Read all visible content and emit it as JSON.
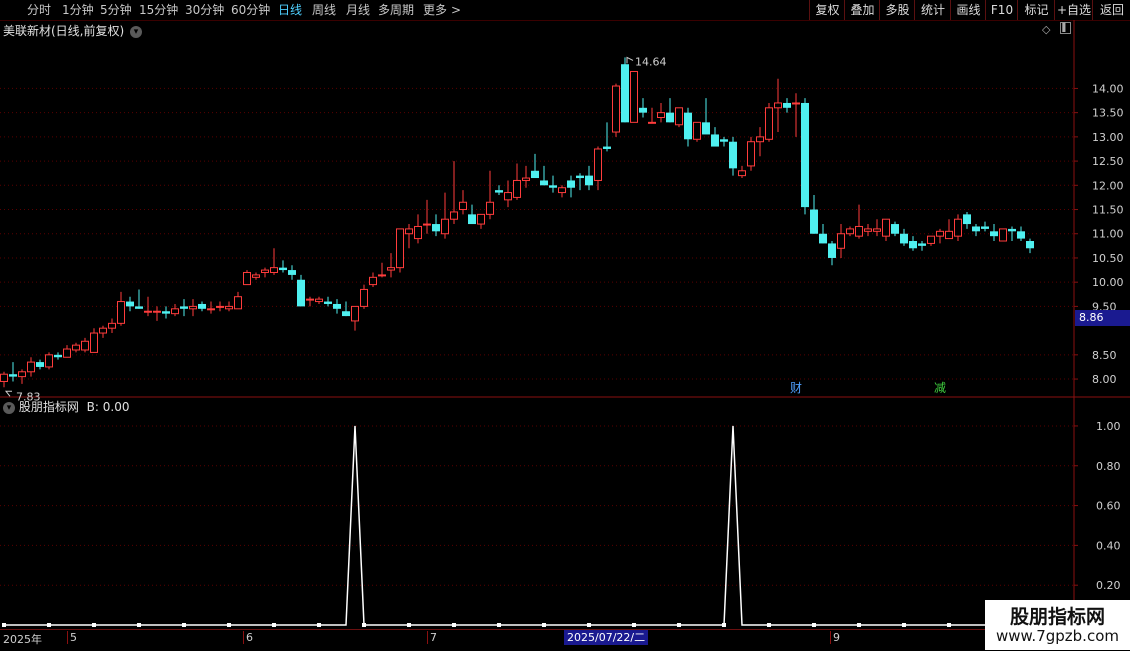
{
  "toolbar": {
    "periods": [
      {
        "label": "分时",
        "active": false
      },
      {
        "label": "1分钟",
        "active": false
      },
      {
        "label": "5分钟",
        "active": false
      },
      {
        "label": "15分钟",
        "active": false
      },
      {
        "label": "30分钟",
        "active": false
      },
      {
        "label": "60分钟",
        "active": false
      },
      {
        "label": "日线",
        "active": true
      },
      {
        "label": "周线",
        "active": false
      },
      {
        "label": "月线",
        "active": false
      },
      {
        "label": "多周期",
        "active": false
      },
      {
        "label": "更多",
        "active": false
      }
    ],
    "more_arrow": ">",
    "right_buttons": [
      "复权",
      "叠加",
      "多股",
      "统计",
      "画线",
      "F10",
      "标记",
      "+自选",
      "返回"
    ]
  },
  "main_chart": {
    "title": "美联新材(日线,前复权)",
    "y_ticks": [
      "14.00",
      "13.50",
      "13.00",
      "12.50",
      "12.00",
      "11.50",
      "11.00",
      "10.50",
      "10.00",
      "9.50",
      "8.50",
      "8.00"
    ],
    "highlight_price": "8.86",
    "max_label": "14.64",
    "min_label": "7.83",
    "markers": [
      {
        "label": "财",
        "color": "#4fa0ff"
      },
      {
        "label": "减",
        "color": "#3fd03f"
      }
    ],
    "colors": {
      "up": "#ff3c3c",
      "down": "#4ff0f0",
      "grid": "#5a0000"
    }
  },
  "indicator": {
    "title": "股朋指标网",
    "b_label": "B: 0.00",
    "y_ticks": [
      "1.00",
      "0.80",
      "0.60",
      "0.40",
      "0.20"
    ]
  },
  "date_axis": {
    "ticks": [
      "2025年",
      "5",
      "6",
      "7",
      "9"
    ],
    "cursor_date": "2025/07/22/二"
  },
  "watermark": {
    "line1": "股朋指标网",
    "line2": "www.7gpzb.com"
  },
  "chart_data": [
    {
      "type": "candlestick",
      "title": "美联新材(日线,前复权)",
      "ylim": [
        7.65,
        15.0
      ],
      "candles": [
        [
          7.95,
          8.15,
          7.83,
          8.1
        ],
        [
          8.1,
          8.35,
          7.95,
          8.05
        ],
        [
          8.05,
          8.2,
          7.9,
          8.15
        ],
        [
          8.15,
          8.45,
          8.05,
          8.35
        ],
        [
          8.35,
          8.4,
          8.2,
          8.25
        ],
        [
          8.25,
          8.55,
          8.2,
          8.5
        ],
        [
          8.5,
          8.55,
          8.4,
          8.45
        ],
        [
          8.45,
          8.7,
          8.45,
          8.62
        ],
        [
          8.6,
          8.75,
          8.55,
          8.7
        ],
        [
          8.6,
          8.85,
          8.55,
          8.78
        ],
        [
          8.55,
          9.05,
          8.55,
          8.95
        ],
        [
          8.95,
          9.1,
          8.85,
          9.05
        ],
        [
          9.05,
          9.25,
          8.95,
          9.15
        ],
        [
          9.15,
          9.8,
          9.1,
          9.6
        ],
        [
          9.6,
          9.7,
          9.4,
          9.5
        ],
        [
          9.5,
          9.85,
          9.45,
          9.45
        ],
        [
          9.4,
          9.7,
          9.3,
          9.4
        ],
        [
          9.4,
          9.5,
          9.2,
          9.4
        ],
        [
          9.4,
          9.5,
          9.25,
          9.35
        ],
        [
          9.35,
          9.55,
          9.3,
          9.45
        ],
        [
          9.5,
          9.65,
          9.3,
          9.45
        ],
        [
          9.45,
          9.65,
          9.3,
          9.5
        ],
        [
          9.55,
          9.6,
          9.4,
          9.45
        ],
        [
          9.45,
          9.6,
          9.35,
          9.45
        ],
        [
          9.5,
          9.6,
          9.4,
          9.5
        ],
        [
          9.45,
          9.6,
          9.4,
          9.5
        ],
        [
          9.45,
          9.8,
          9.45,
          9.7
        ],
        [
          9.95,
          10.25,
          9.95,
          10.2
        ],
        [
          10.1,
          10.2,
          10.05,
          10.15
        ],
        [
          10.2,
          10.3,
          10.1,
          10.25
        ],
        [
          10.2,
          10.7,
          10.15,
          10.3
        ],
        [
          10.3,
          10.45,
          10.2,
          10.25
        ],
        [
          10.25,
          10.35,
          10.05,
          10.15
        ],
        [
          10.05,
          10.15,
          9.65,
          9.5
        ],
        [
          9.65,
          9.7,
          9.5,
          9.65
        ],
        [
          9.6,
          9.7,
          9.55,
          9.65
        ],
        [
          9.6,
          9.7,
          9.5,
          9.55
        ],
        [
          9.55,
          9.65,
          9.35,
          9.45
        ],
        [
          9.4,
          9.6,
          9.3,
          9.3
        ],
        [
          9.2,
          9.5,
          9.0,
          9.5
        ],
        [
          9.5,
          9.95,
          9.45,
          9.85
        ],
        [
          9.95,
          10.2,
          9.9,
          10.1
        ],
        [
          10.15,
          10.4,
          10.1,
          10.15
        ],
        [
          10.25,
          10.6,
          10.1,
          10.3
        ],
        [
          10.3,
          11.1,
          10.2,
          11.1
        ],
        [
          11.0,
          11.2,
          10.7,
          11.1
        ],
        [
          10.9,
          11.4,
          10.8,
          11.15
        ],
        [
          11.2,
          11.7,
          11.0,
          11.2
        ],
        [
          11.2,
          11.4,
          10.95,
          11.05
        ],
        [
          11.0,
          11.85,
          10.9,
          11.3
        ],
        [
          11.3,
          12.5,
          11.2,
          11.45
        ],
        [
          11.5,
          11.9,
          11.4,
          11.65
        ],
        [
          11.4,
          11.6,
          11.2,
          11.2
        ],
        [
          11.2,
          11.4,
          11.1,
          11.4
        ],
        [
          11.4,
          12.3,
          11.3,
          11.65
        ],
        [
          11.9,
          12.0,
          11.8,
          11.85
        ],
        [
          11.7,
          12.1,
          11.55,
          11.85
        ],
        [
          11.75,
          12.45,
          11.7,
          12.1
        ],
        [
          12.1,
          12.4,
          11.95,
          12.15
        ],
        [
          12.3,
          12.65,
          12.2,
          12.15
        ],
        [
          12.1,
          12.4,
          12.0,
          12.0
        ],
        [
          12.0,
          12.2,
          11.85,
          11.95
        ],
        [
          11.85,
          12.0,
          11.75,
          11.95
        ],
        [
          12.1,
          12.2,
          11.75,
          11.95
        ],
        [
          12.2,
          12.25,
          11.9,
          12.15
        ],
        [
          12.2,
          12.4,
          11.9,
          12.0
        ],
        [
          12.1,
          12.8,
          11.9,
          12.75
        ],
        [
          12.8,
          13.3,
          12.7,
          12.75
        ],
        [
          13.1,
          14.1,
          13.0,
          14.05
        ],
        [
          14.5,
          14.64,
          13.3,
          13.3
        ],
        [
          13.3,
          13.9,
          13.3,
          14.35
        ],
        [
          13.6,
          13.8,
          13.4,
          13.5
        ],
        [
          13.3,
          13.6,
          13.3,
          13.3
        ],
        [
          13.4,
          13.7,
          13.3,
          13.5
        ],
        [
          13.5,
          13.8,
          13.3,
          13.3
        ],
        [
          13.25,
          13.6,
          13.2,
          13.6
        ],
        [
          13.5,
          13.6,
          12.8,
          12.95
        ],
        [
          12.95,
          13.3,
          12.9,
          13.3
        ],
        [
          13.3,
          13.8,
          13.2,
          13.05
        ],
        [
          13.05,
          13.2,
          12.8,
          12.8
        ],
        [
          12.95,
          13.0,
          12.8,
          12.9
        ],
        [
          12.9,
          13.0,
          12.2,
          12.35
        ],
        [
          12.2,
          12.4,
          12.15,
          12.3
        ],
        [
          12.4,
          13.0,
          12.3,
          12.9
        ],
        [
          12.9,
          13.2,
          12.6,
          13.0
        ],
        [
          12.95,
          13.7,
          12.9,
          13.6
        ],
        [
          13.6,
          14.2,
          13.1,
          13.7
        ],
        [
          13.7,
          13.8,
          13.5,
          13.6
        ],
        [
          13.7,
          13.9,
          13.0,
          13.7
        ],
        [
          13.7,
          13.8,
          11.4,
          11.55
        ],
        [
          11.5,
          11.8,
          11.0,
          11.0
        ],
        [
          11.0,
          11.2,
          10.8,
          10.8
        ],
        [
          10.8,
          10.85,
          10.35,
          10.5
        ],
        [
          10.7,
          11.2,
          10.5,
          11.0
        ],
        [
          11.0,
          11.15,
          10.95,
          11.1
        ],
        [
          10.95,
          11.6,
          10.9,
          11.15
        ],
        [
          11.05,
          11.2,
          10.95,
          11.1
        ],
        [
          11.05,
          11.3,
          10.95,
          11.1
        ],
        [
          10.95,
          11.25,
          10.85,
          11.3
        ],
        [
          11.2,
          11.25,
          10.95,
          11.0
        ],
        [
          11.0,
          11.1,
          10.75,
          10.8
        ],
        [
          10.85,
          10.95,
          10.65,
          10.7
        ],
        [
          10.8,
          10.85,
          10.65,
          10.75
        ],
        [
          10.8,
          10.95,
          10.75,
          10.95
        ],
        [
          10.95,
          11.1,
          10.8,
          11.05
        ],
        [
          10.9,
          11.3,
          10.9,
          11.05
        ],
        [
          10.95,
          11.4,
          10.85,
          11.3
        ],
        [
          11.4,
          11.45,
          11.1,
          11.2
        ],
        [
          11.15,
          11.2,
          10.95,
          11.05
        ],
        [
          11.15,
          11.25,
          11.05,
          11.1
        ],
        [
          11.05,
          11.2,
          10.85,
          10.95
        ],
        [
          10.85,
          11.1,
          10.85,
          11.1
        ],
        [
          11.1,
          11.15,
          10.85,
          11.05
        ],
        [
          11.05,
          11.15,
          10.85,
          10.9
        ],
        [
          10.85,
          10.9,
          10.6,
          10.7
        ]
      ]
    },
    {
      "type": "line",
      "title": "股朋指标网",
      "ylim": [
        0,
        1.05
      ],
      "x": [
        0,
        18,
        38,
        39,
        40,
        80,
        81,
        82,
        117
      ],
      "values": [
        0,
        0,
        0,
        1,
        0,
        0,
        1,
        0,
        0
      ],
      "ylabel": "B"
    }
  ]
}
